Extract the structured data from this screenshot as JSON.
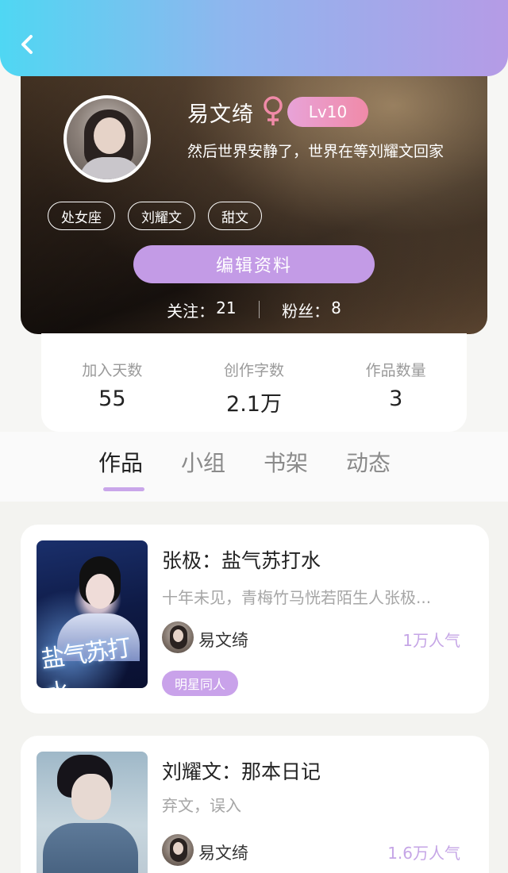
{
  "header": {
    "back_icon": "chevron-left-icon",
    "gradient": [
      "#4fd7f3",
      "#b59be6"
    ]
  },
  "profile": {
    "name": "易文绮",
    "gender_icon": "female-icon",
    "gender_color": "#f08aa8",
    "level": "Lv10",
    "signature": "然后世界安静了，世界在等刘耀文回家",
    "tags": [
      "处女座",
      "刘耀文",
      "甜文"
    ],
    "edit_label": "编辑资料",
    "following_label": "关注：",
    "following_count": "21",
    "fans_label": "粉丝：",
    "fans_count": "8"
  },
  "stats": [
    {
      "label": "加入天数",
      "value": "55"
    },
    {
      "label": "创作字数",
      "value": "2.1万"
    },
    {
      "label": "作品数量",
      "value": "3"
    }
  ],
  "tabs": [
    "作品",
    "小组",
    "书架",
    "动态"
  ],
  "active_tab": "作品",
  "accent_color": "#c9a6ea",
  "works": [
    {
      "title": "张极：盐气苏打水",
      "description": "十年未见，青梅竹马恍若陌生人张极...",
      "author": "易文绮",
      "popularity": "1万人气",
      "category": "明星同人",
      "cover_text": "盐气苏打水"
    },
    {
      "title": "刘耀文：那本日记",
      "description": "弃文，误入",
      "author": "易文绮",
      "popularity": "1.6万人气"
    }
  ]
}
